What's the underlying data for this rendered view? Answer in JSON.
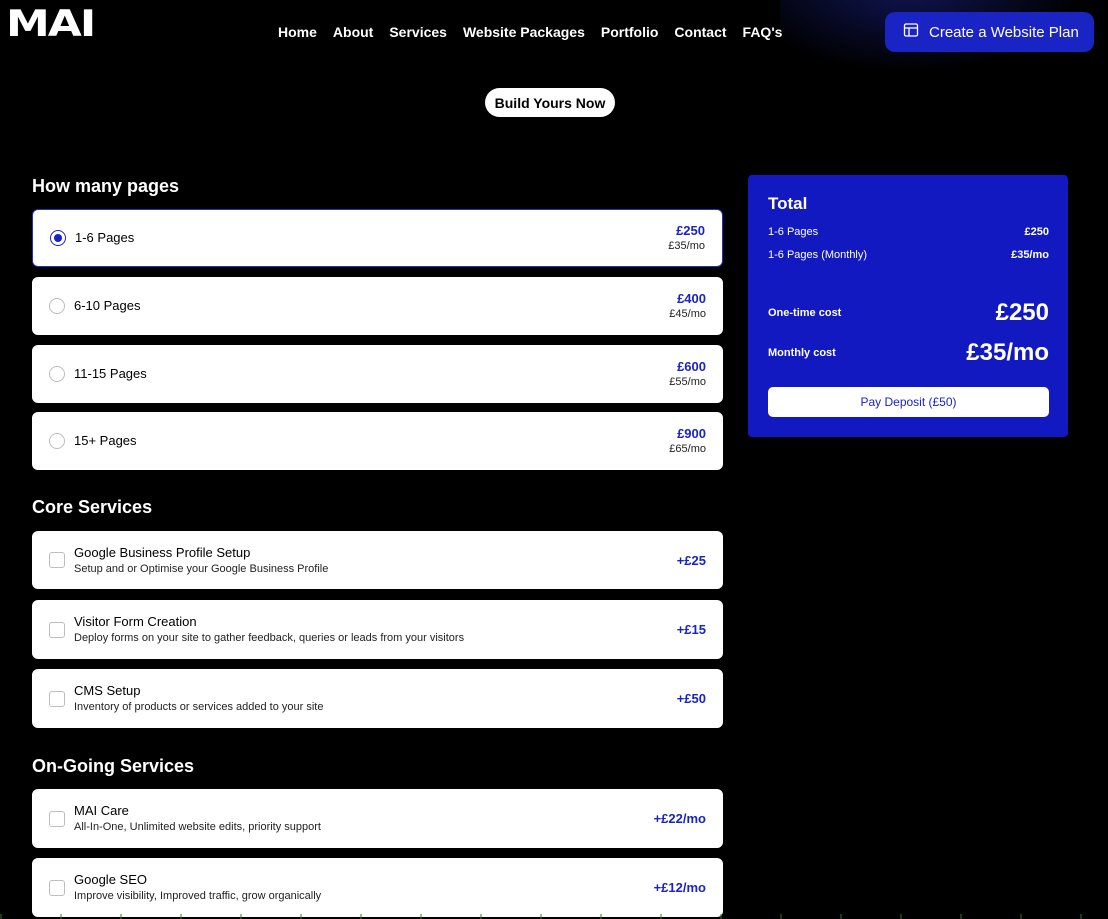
{
  "header": {
    "logo": "MAI",
    "nav": [
      "Home",
      "About",
      "Services",
      "Website Packages",
      "Portfolio",
      "Contact",
      "FAQ's"
    ],
    "cta_label": "Create a Website Plan",
    "cta_icon": "layout-icon"
  },
  "hero": {
    "pill_label": "Build Yours Now"
  },
  "pages": {
    "title": "How many pages",
    "options": [
      {
        "label": "1-6 Pages",
        "price": "£250",
        "monthly": "£35/mo",
        "selected": true
      },
      {
        "label": "6-10 Pages",
        "price": "£400",
        "monthly": "£45/mo",
        "selected": false
      },
      {
        "label": "11-15 Pages",
        "price": "£600",
        "monthly": "£55/mo",
        "selected": false
      },
      {
        "label": "15+ Pages",
        "price": "£900",
        "monthly": "£65/mo",
        "selected": false
      }
    ]
  },
  "core": {
    "title": "Core Services",
    "items": [
      {
        "title": "Google Business Profile Setup",
        "desc": "Setup and or Optimise your Google Business Profile",
        "price": "+£25"
      },
      {
        "title": "Visitor Form Creation",
        "desc": "Deploy forms on your site to gather feedback, queries or leads from your visitors",
        "price": "+£15"
      },
      {
        "title": "CMS Setup",
        "desc": "Inventory of products or services added to your site",
        "price": "+£50"
      }
    ]
  },
  "ongoing": {
    "title": "On-Going Services",
    "items": [
      {
        "title": "MAI Care",
        "desc": "All-In-One, Unlimited website edits, priority support",
        "price": "+£22/mo"
      },
      {
        "title": "Google SEO",
        "desc": "Improve visibility, Improved traffic, grow organically",
        "price": "+£12/mo"
      }
    ]
  },
  "total": {
    "title": "Total",
    "lines": [
      {
        "label": "1-6 Pages",
        "value": "£250"
      },
      {
        "label": "1-6 Pages (Monthly)",
        "value": "£35/mo"
      }
    ],
    "one_time_label": "One-time cost",
    "one_time_value": "£250",
    "monthly_label": "Monthly cost",
    "monthly_value": "£35/mo",
    "pay_label": "Pay Deposit (£50)"
  },
  "colors": {
    "accent": "#1a23c4",
    "panel": "#1219c0",
    "background": "#000000"
  }
}
